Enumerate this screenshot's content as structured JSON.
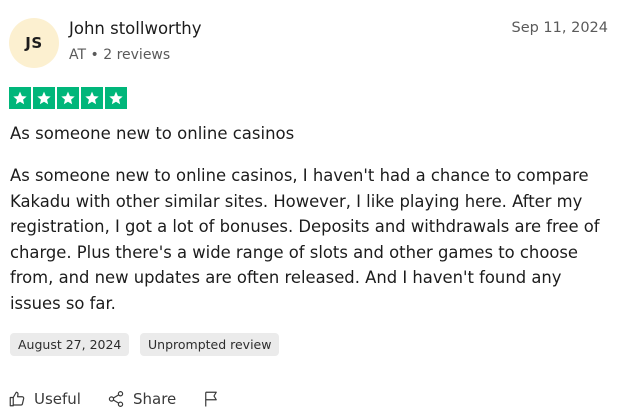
{
  "reviewer": {
    "initials": "JS",
    "name": "John stollworthy",
    "country": "AT",
    "separator": "•",
    "reviews_count": "2 reviews"
  },
  "review": {
    "date": "Sep 11, 2024",
    "rating": 5,
    "rating_max": 5,
    "title": "As someone new to online casinos",
    "body": "As someone new to online casinos, I haven't had a chance to compare Kakadu with other similar sites. However, I like playing here. After my registration, I got a lot of bonuses. Deposits and withdrawals are free of charge. Plus there's a wide range of slots and other games to choose from, and new updates are often released. And I haven't found any issues so far.",
    "experience_date": "August 27, 2024",
    "review_type": "Unprompted review"
  },
  "actions": {
    "useful_label": "Useful",
    "share_label": "Share",
    "useful_icon": "thumbs-up-icon",
    "share_icon": "share-icon",
    "flag_icon": "flag-icon"
  },
  "colors": {
    "star_green": "#00b67a",
    "avatar_bg": "#fcf0d0",
    "chip_bg": "#ebebeb"
  }
}
